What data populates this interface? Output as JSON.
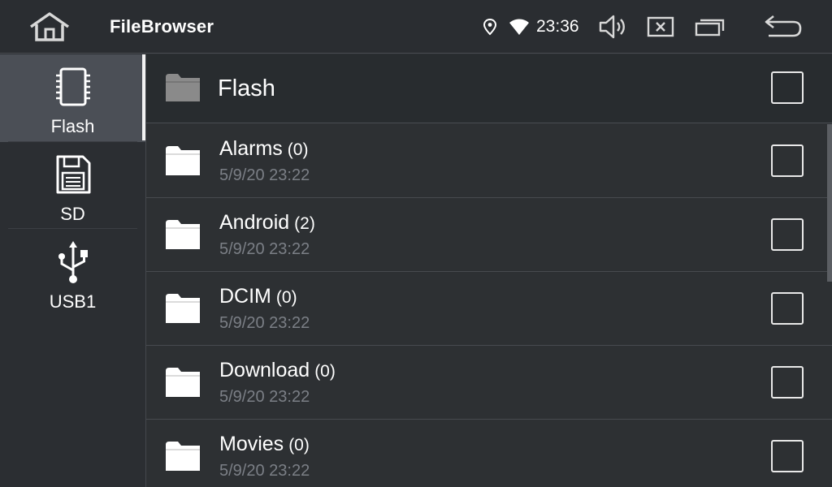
{
  "topbar": {
    "title": "FileBrowser",
    "clock": "23:36",
    "icons": [
      "home-icon",
      "location-icon",
      "wifi-icon",
      "volume-icon",
      "close-box-icon",
      "recent-apps-icon",
      "back-arrow-icon"
    ]
  },
  "sidebar": {
    "items": [
      {
        "label": "Flash",
        "icon": "chip-icon",
        "active": true
      },
      {
        "label": "SD",
        "icon": "sd-card-icon",
        "active": false
      },
      {
        "label": "USB1",
        "icon": "usb-icon",
        "active": false
      }
    ]
  },
  "main": {
    "header_title": "Flash",
    "rows": [
      {
        "name": "Alarms",
        "count": "(0)",
        "date": "5/9/20 23:22"
      },
      {
        "name": "Android",
        "count": "(2)",
        "date": "5/9/20 23:22"
      },
      {
        "name": "DCIM",
        "count": "(0)",
        "date": "5/9/20 23:22"
      },
      {
        "name": "Download",
        "count": "(0)",
        "date": "5/9/20 23:22"
      },
      {
        "name": "Movies",
        "count": "(0)",
        "date": "5/9/20 23:22"
      }
    ]
  },
  "colors": {
    "background": "#2b2e32",
    "active_sidebar": "#4b4f56",
    "date_text": "#7b7f86",
    "header_folder": "#8a8a8a"
  }
}
